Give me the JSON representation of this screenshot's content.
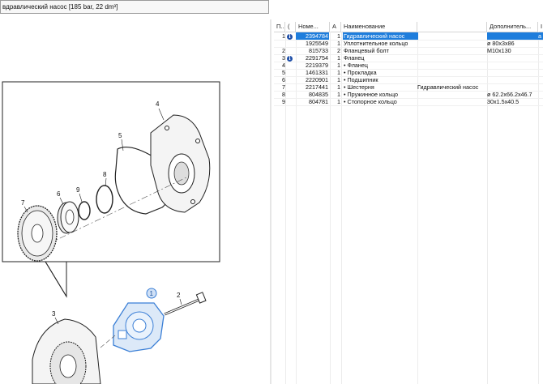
{
  "window": {
    "title": "вдравлический насос [185 bar,  22 dm³]"
  },
  "diagram": {
    "callouts": [
      "1",
      "2",
      "3",
      "4",
      "5",
      "6",
      "7",
      "8",
      "9"
    ]
  },
  "table": {
    "headers": [
      "П..",
      "(",
      "Номе...",
      "А",
      "Наименование",
      "",
      "Дополнитель...",
      "I"
    ],
    "rows": [
      {
        "pos": "1",
        "info": "i",
        "num": "2394784",
        "qty": "1",
        "name": "Гидравлический насос",
        "note": "",
        "add": "",
        "last": "a",
        "selected": true
      },
      {
        "pos": "",
        "info": "",
        "num": "1925549",
        "qty": "1",
        "name": "Уплотнительное кольцо",
        "note": "",
        "add": "ø 80x3x86",
        "last": ""
      },
      {
        "pos": "2",
        "info": "",
        "num": "815733",
        "qty": "2",
        "name": "Фланцевый болт",
        "note": "",
        "add": "M10x130",
        "last": ""
      },
      {
        "pos": "3",
        "info": "i",
        "num": "2291754",
        "qty": "1",
        "name": "Фланец",
        "note": "",
        "add": "",
        "last": ""
      },
      {
        "pos": "4",
        "info": "",
        "num": "2219379",
        "qty": "1",
        "name": "• Фланец",
        "note": "",
        "add": "",
        "last": ""
      },
      {
        "pos": "5",
        "info": "",
        "num": "1461331",
        "qty": "1",
        "name": "• Прокладка",
        "note": "",
        "add": "",
        "last": ""
      },
      {
        "pos": "6",
        "info": "",
        "num": "2220901",
        "qty": "1",
        "name": "• Подшипник",
        "note": "",
        "add": "",
        "last": ""
      },
      {
        "pos": "7",
        "info": "",
        "num": "2217441",
        "qty": "1",
        "name": "• Шестерня",
        "note": "Гидравлический насос",
        "add": "",
        "last": ""
      },
      {
        "pos": "8",
        "info": "",
        "num": "804835",
        "qty": "1",
        "name": "• Пружинное кольцо",
        "note": "",
        "add": "ø 62.2x66.2x46.7",
        "last": ""
      },
      {
        "pos": "9",
        "info": "",
        "num": "804781",
        "qty": "1",
        "name": "• Стопорное кольцо",
        "note": "",
        "add": "30x1.5x40.5",
        "last": ""
      }
    ]
  },
  "colors": {
    "selection": "#1e7ddc",
    "info_icon": "#1f4fa8",
    "highlight_part": "#3b7fd6"
  }
}
